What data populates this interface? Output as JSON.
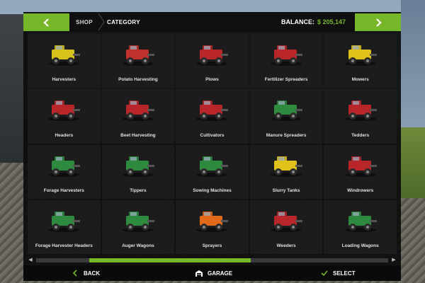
{
  "header": {
    "crumb_shop": "SHOP",
    "crumb_category": "CATEGORY",
    "balance_label": "BALANCE:",
    "balance_value": "$ 205,147"
  },
  "categories": [
    {
      "label": "Harvesters",
      "icon": "harvester-icon",
      "color": "#d7c21c"
    },
    {
      "label": "Potato Harvesting",
      "icon": "potato-harvester-icon",
      "color": "#c0302c"
    },
    {
      "label": "Plows",
      "icon": "plow-icon",
      "color": "#b8262a"
    },
    {
      "label": "Fertilizer Spreaders",
      "icon": "fertilizer-spreader-icon",
      "color": "#b8262a"
    },
    {
      "label": "Mowers",
      "icon": "mower-icon",
      "color": "#e0c21a"
    },
    {
      "label": "Headers",
      "icon": "header-icon",
      "color": "#b8262a"
    },
    {
      "label": "Beet Harvesting",
      "icon": "beet-harvester-icon",
      "color": "#b8262a"
    },
    {
      "label": "Cultivators",
      "icon": "cultivator-icon",
      "color": "#b8262a"
    },
    {
      "label": "Manure Spreaders",
      "icon": "manure-spreader-icon",
      "color": "#2e8a3e"
    },
    {
      "label": "Tedders",
      "icon": "tedder-icon",
      "color": "#b8262a"
    },
    {
      "label": "Forage Harvesters",
      "icon": "forage-harvester-icon",
      "color": "#2e8a3e"
    },
    {
      "label": "Tippers",
      "icon": "tipper-icon",
      "color": "#2e8a3e"
    },
    {
      "label": "Sowing Machines",
      "icon": "sowing-machine-icon",
      "color": "#2e8a3e"
    },
    {
      "label": "Slurry Tanks",
      "icon": "slurry-tank-icon",
      "color": "#e0c21a"
    },
    {
      "label": "Windrowers",
      "icon": "windrower-icon",
      "color": "#b8262a"
    },
    {
      "label": "Forage Harvester Headers",
      "icon": "forage-header-icon",
      "color": "#2e8a3e"
    },
    {
      "label": "Auger Wagons",
      "icon": "auger-wagon-icon",
      "color": "#2e8a3e"
    },
    {
      "label": "Sprayers",
      "icon": "sprayer-icon",
      "color": "#e06a1a"
    },
    {
      "label": "Weeders",
      "icon": "weeder-icon",
      "color": "#b8262a"
    },
    {
      "label": "Loading Wagons",
      "icon": "loading-wagon-icon",
      "color": "#2e8a3e"
    }
  ],
  "scrollbar": {
    "position": 0.15,
    "visible_fraction": 0.46
  },
  "footer": {
    "back_label": "BACK",
    "garage_label": "GARAGE",
    "select_label": "SELECT"
  },
  "colors": {
    "accent": "#76b82a",
    "panel": "#0f0f0f",
    "cell": "#1c1c1c"
  }
}
